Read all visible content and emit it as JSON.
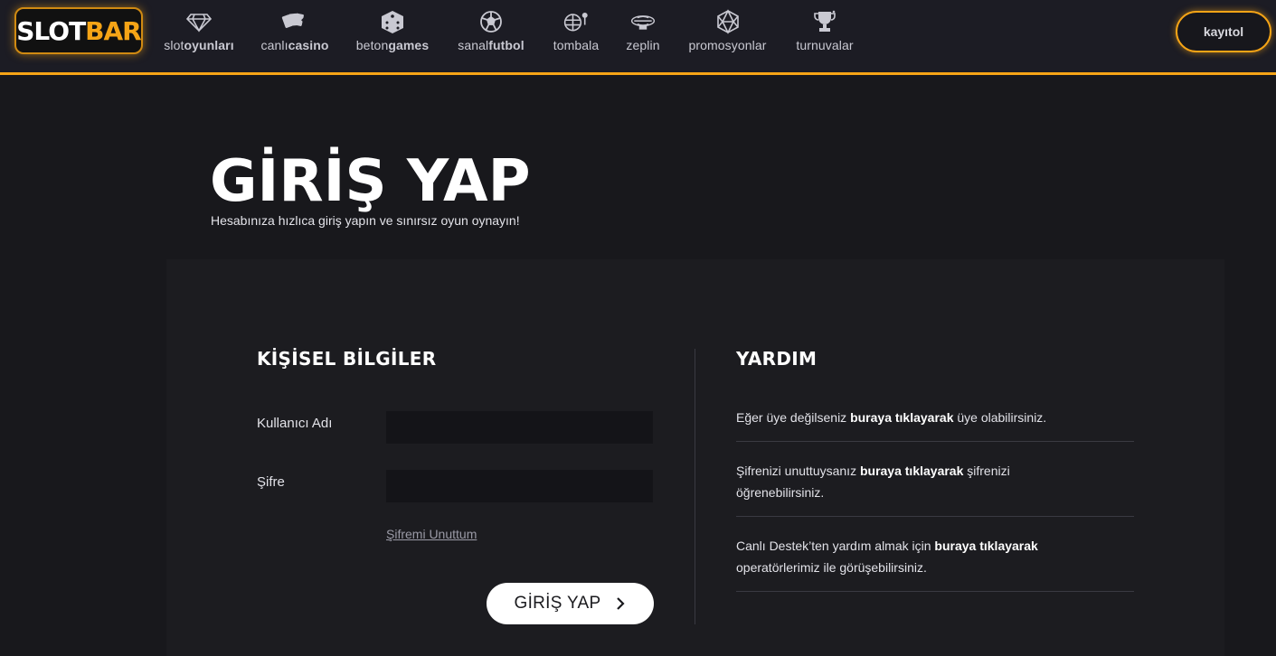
{
  "logo": {
    "part1": "SLOT",
    "part2": "BAR"
  },
  "nav": [
    {
      "light": "slot",
      "bold": "oyunları",
      "icon": "diamond-icon"
    },
    {
      "light": "canlı",
      "bold": "casino",
      "icon": "cards-icon"
    },
    {
      "light": "beton",
      "bold": "games",
      "icon": "dice-icon"
    },
    {
      "light": "sanal",
      "bold": "futbol",
      "icon": "soccer-ball-icon"
    },
    {
      "light": "tombala",
      "bold": "",
      "icon": "lottery-balls-icon"
    },
    {
      "light": "zeplin",
      "bold": "",
      "icon": "zeppelin-icon"
    },
    {
      "light": "promosyonlar",
      "bold": "",
      "icon": "polyhedron-icon"
    },
    {
      "light": "turnuvalar",
      "bold": "",
      "icon": "trophy-icon"
    }
  ],
  "register_label": "kayıtol",
  "page": {
    "title": "GİRİŞ YAP",
    "subtitle": "Hesabınıza hızlıca giriş yapın ve sınırsız oyun oynayın!"
  },
  "form": {
    "title": "KİŞİSEL BİLGİLER",
    "username_label": "Kullanıcı Adı",
    "username_value": "",
    "password_label": "Şifre",
    "password_value": "",
    "forgot_label": "Şifremi Unuttum",
    "submit_label": "GİRİŞ YAP"
  },
  "help": {
    "title": "YARDIM",
    "items": [
      {
        "before": "Eğer üye değilseniz ",
        "link": "buraya tıklayarak",
        "after": " üye olabilirsiniz."
      },
      {
        "before": "Şifrenizi unuttuysanız ",
        "link": "buraya tıklayarak",
        "after": " şifrenizi öğrenebilirsiniz."
      },
      {
        "before": "Canlı Destek’ten yardım almak için ",
        "link": "buraya tıklayarak",
        "after": " operatörlerimiz ile görüşebilirsiniz."
      }
    ]
  },
  "colors": {
    "accent": "#f5a416",
    "background": "#18181c",
    "header": "#1c1c24",
    "panel": "#1c1c20"
  }
}
